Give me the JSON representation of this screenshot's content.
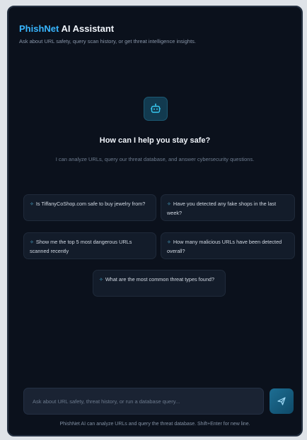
{
  "header": {
    "brand": "PhishNet",
    "title_rest": " AI Assistant",
    "subtitle": "Ask about URL safety, query scan history, or get threat intelligence insights."
  },
  "hero": {
    "icon": "bot-icon",
    "title": "How can I help you stay safe?",
    "subtitle": "I can analyze URLs, query our threat database, and answer cybersecurity questions."
  },
  "suggestions": [
    {
      "icon": "sparkle-icon",
      "text": "Is TiffanyCoShop.com safe to buy jewelry from?"
    },
    {
      "icon": "sparkle-icon",
      "text": "Have you detected any fake shops in the last week?"
    },
    {
      "icon": "sparkle-icon",
      "text": "Show me the top 5 most dangerous URLs scanned recently"
    },
    {
      "icon": "sparkle-icon",
      "text": "How many malicious URLs have been detected overall?"
    },
    {
      "icon": "sparkle-icon",
      "text": "What are the most common threat types found?"
    }
  ],
  "composer": {
    "placeholder": "Ask about URL safety, threat history, or run a database query...",
    "value": "",
    "send_icon": "send-icon"
  },
  "footer": {
    "note": "PhishNet AI can analyze URLs and query the threat database. Shift+Enter for new line."
  },
  "colors": {
    "accent": "#38b6ff",
    "background": "#0b111c",
    "card": "#131c2a"
  }
}
